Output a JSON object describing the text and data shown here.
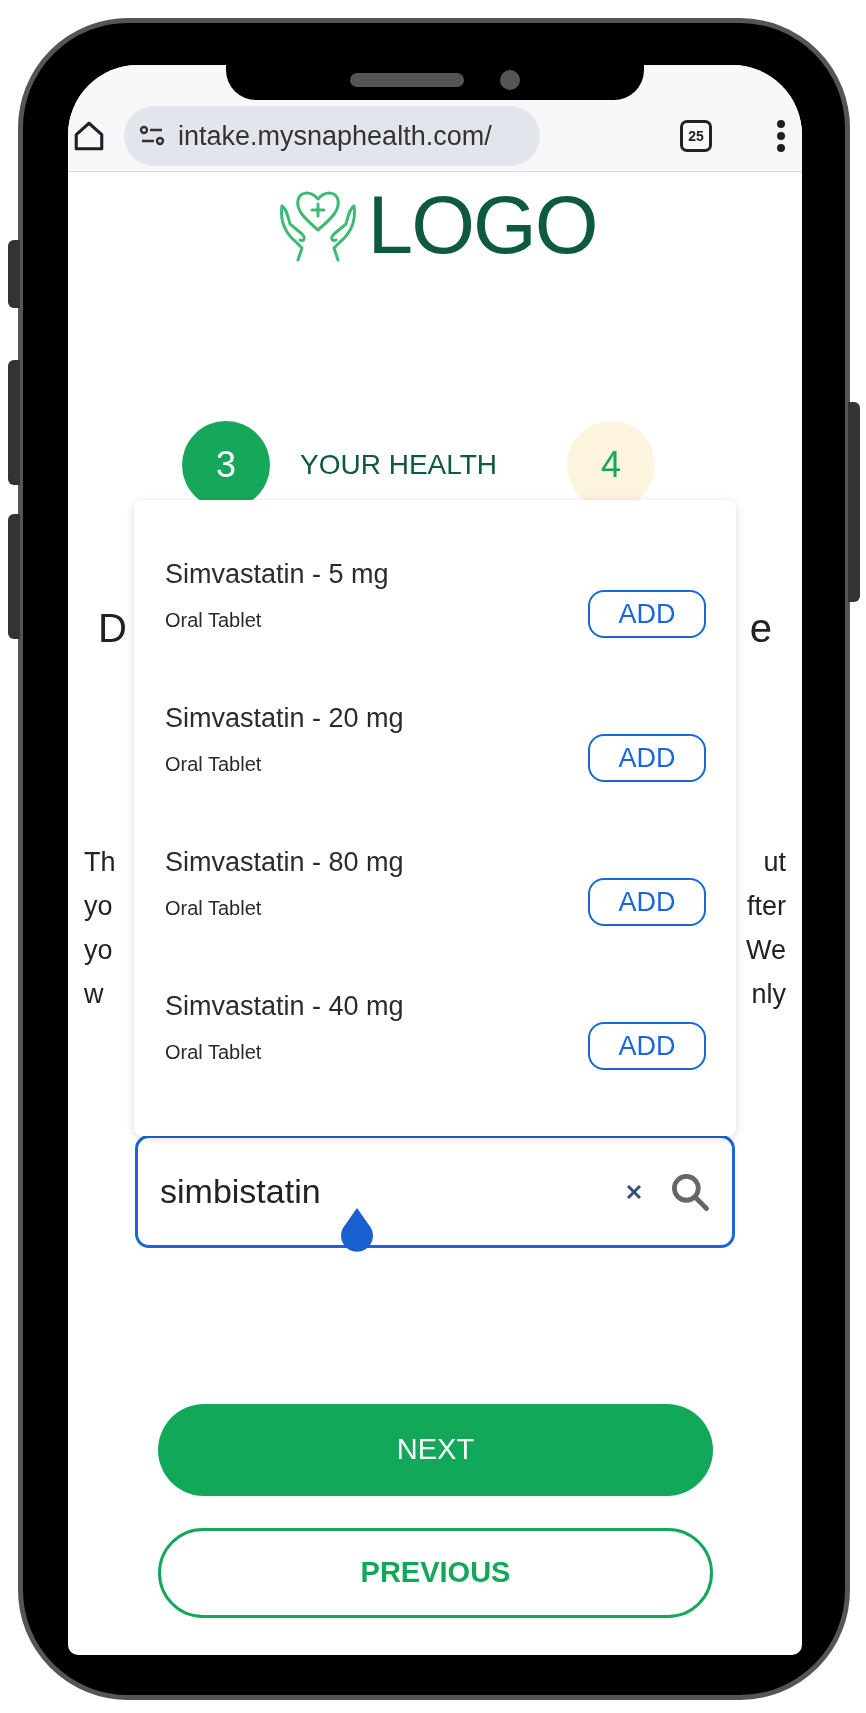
{
  "browser": {
    "url": "intake.mysnaphealth.com/",
    "tab_count": "25"
  },
  "logo": {
    "text": "LOGO"
  },
  "steps": [
    {
      "number": "3",
      "label": "YOUR HEALTH",
      "active": true
    },
    {
      "number": "4",
      "active": false
    }
  ],
  "heading_fragments": {
    "left": "D",
    "right": "e"
  },
  "paragraph_fragments": [
    {
      "left": "Th",
      "right": "ut"
    },
    {
      "left": "yo",
      "right": "fter"
    },
    {
      "left": "yo",
      "right": "We"
    },
    {
      "left": "w",
      "right": "nly"
    }
  ],
  "suggestions": [
    {
      "name": "Simvastatin - 5 mg",
      "form": "Oral Tablet",
      "action": "ADD"
    },
    {
      "name": "Simvastatin - 20 mg",
      "form": "Oral Tablet",
      "action": "ADD"
    },
    {
      "name": "Simvastatin - 80 mg",
      "form": "Oral Tablet",
      "action": "ADD"
    },
    {
      "name": "Simvastatin - 40 mg",
      "form": "Oral Tablet",
      "action": "ADD"
    }
  ],
  "search": {
    "value": "simbistatin"
  },
  "buttons": [
    {
      "label": "NEXT",
      "kind": "primary"
    },
    {
      "label": "PREVIOUS",
      "kind": "secondary"
    }
  ]
}
